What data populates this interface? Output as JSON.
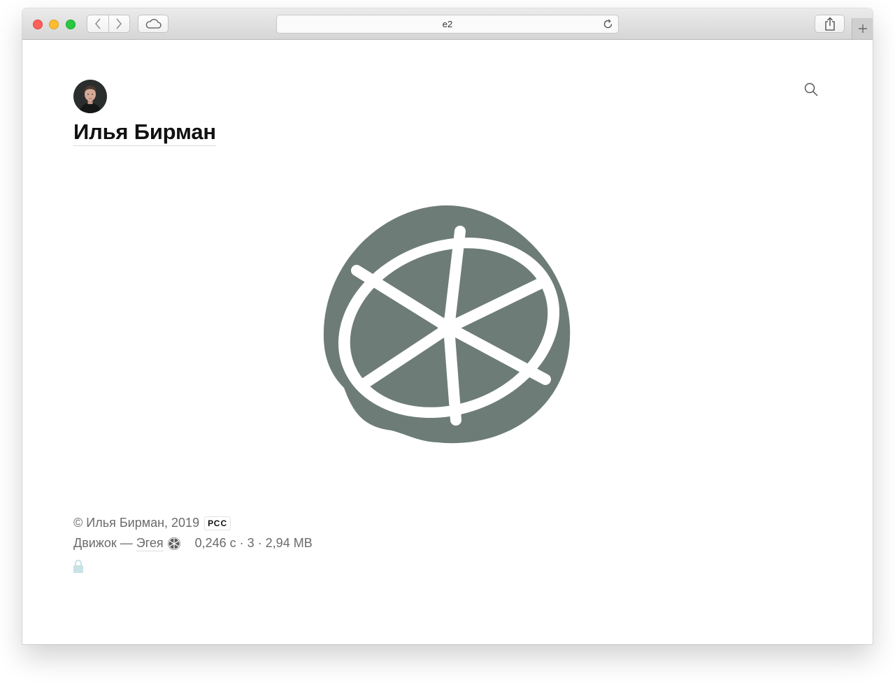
{
  "browser": {
    "address": "e2",
    "icons": {
      "back": "chevron-left-icon",
      "forward": "chevron-right-icon",
      "cloud": "cloud-icon",
      "reload": "reload-icon",
      "share": "share-icon",
      "new_tab": "plus-icon"
    }
  },
  "blog": {
    "title": "Илья Бирман",
    "avatar": "avatar-photo",
    "logo": "lime-slice-logo",
    "accent_color": "#6d7c76"
  },
  "footer": {
    "copyright": "© Илья Бирман, 2019",
    "rss_label": "РСС",
    "engine_prefix": "Движок — ",
    "engine_name": "Эгея",
    "stats": "0,246 с · 3 · 2,94 МВ",
    "lock_color": "#c8e2e5"
  }
}
